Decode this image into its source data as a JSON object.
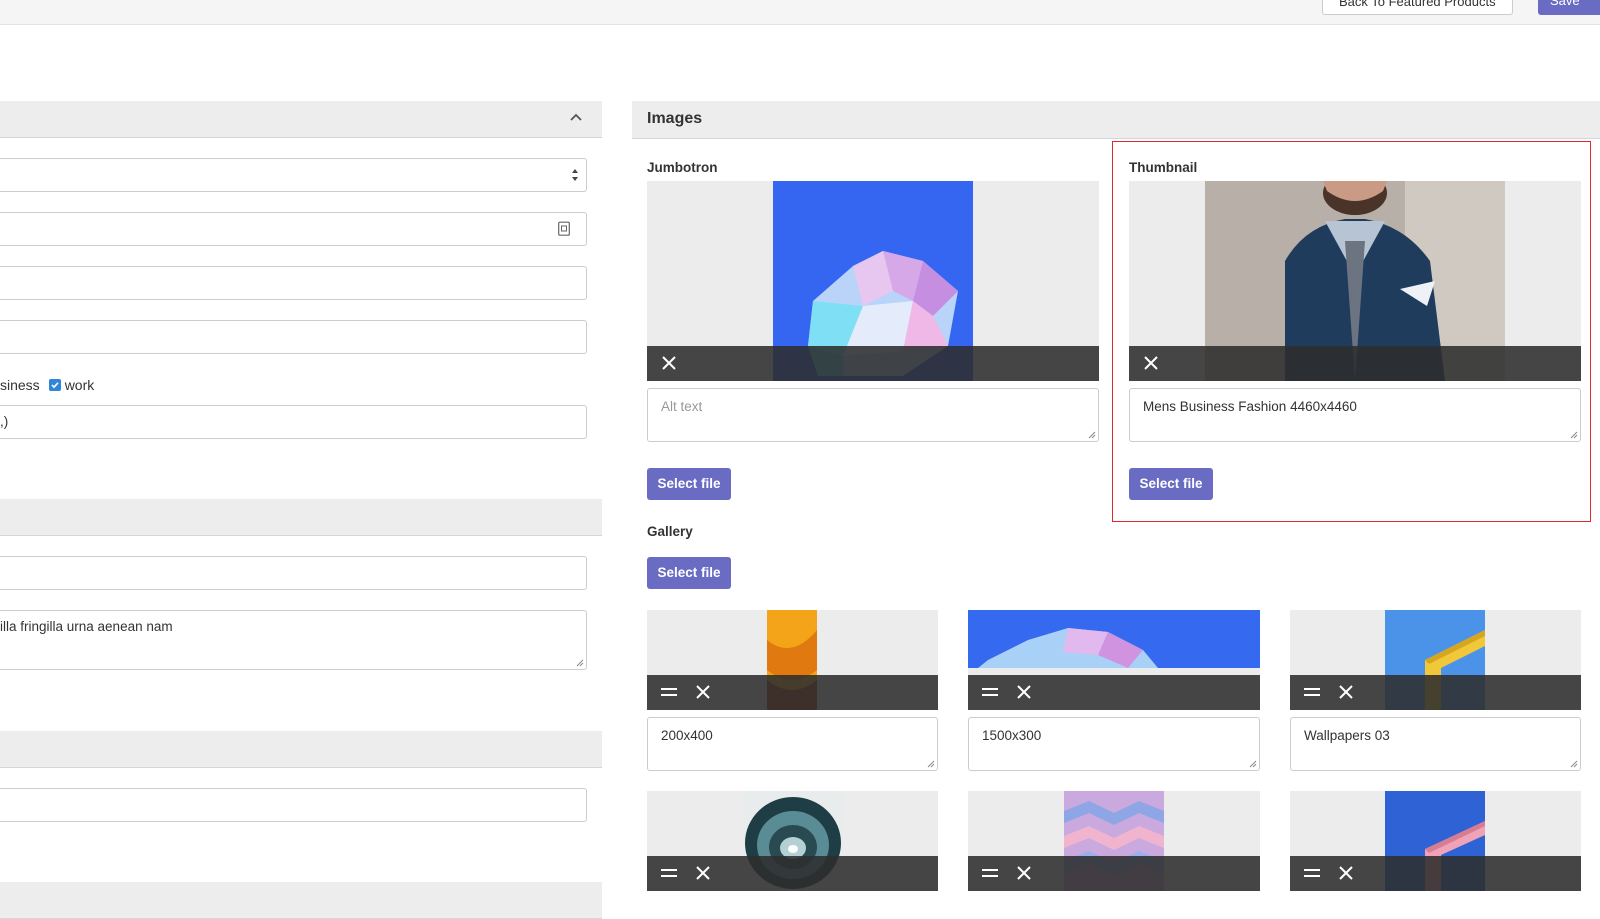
{
  "header": {
    "back_label": "Back To Featured Products",
    "save_label": "Save"
  },
  "form": {
    "tags_partial_label": "siness",
    "tag_checkbox_label": "work",
    "tags_input_value": ",)",
    "description_value": "illa fringilla urna aenean nam"
  },
  "images": {
    "section_title": "Images",
    "jumbotron": {
      "label": "Jumbotron",
      "alt_placeholder": "Alt text",
      "alt_value": "",
      "select_label": "Select file"
    },
    "thumbnail": {
      "label": "Thumbnail",
      "alt_value": "Mens Business Fashion 4460x4460",
      "select_label": "Select file"
    },
    "gallery": {
      "label": "Gallery",
      "select_label": "Select file",
      "items": [
        {
          "alt": "200x400"
        },
        {
          "alt": "1500x300"
        },
        {
          "alt": "Wallpapers 03"
        },
        {
          "alt": ""
        },
        {
          "alt": ""
        },
        {
          "alt": ""
        }
      ]
    }
  },
  "colors": {
    "primary_button": "#6a6cc4",
    "highlight_border": "#e0282e",
    "checkbox": "#2f86d8"
  }
}
